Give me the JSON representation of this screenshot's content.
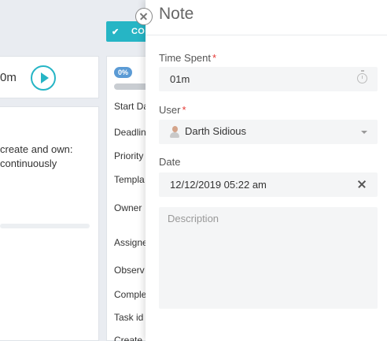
{
  "background": {
    "complete_button": {
      "label": "CO",
      "icon": "check-icon"
    },
    "timer": {
      "value": "0m",
      "play_icon": "play-icon"
    },
    "description_lines": [
      "create and own:",
      "continuously"
    ],
    "progress": {
      "badge": "0%",
      "fraction": 0
    },
    "detail_labels": [
      "Start Da",
      "Deadlin",
      "Priority",
      "Templa",
      "Owner",
      "Assigne",
      "Observ",
      "Comple",
      "Task id",
      "Create"
    ]
  },
  "note_panel": {
    "title": "Note",
    "close_icon": "close-icon",
    "time_spent": {
      "label": "Time Spent",
      "required_mark": "*",
      "value": "01m",
      "icon": "timer-icon"
    },
    "user": {
      "label": "User",
      "required_mark": "*",
      "value": "Darth Sidious",
      "icon": "chevron-down-icon"
    },
    "date": {
      "label": "Date",
      "value": "12/12/2019 05:22 am",
      "icon": "clear-icon"
    },
    "description": {
      "placeholder": "Description"
    }
  },
  "colors": {
    "accent": "#26b5c5",
    "required": "#e53935",
    "badge": "#5b9bd5"
  }
}
